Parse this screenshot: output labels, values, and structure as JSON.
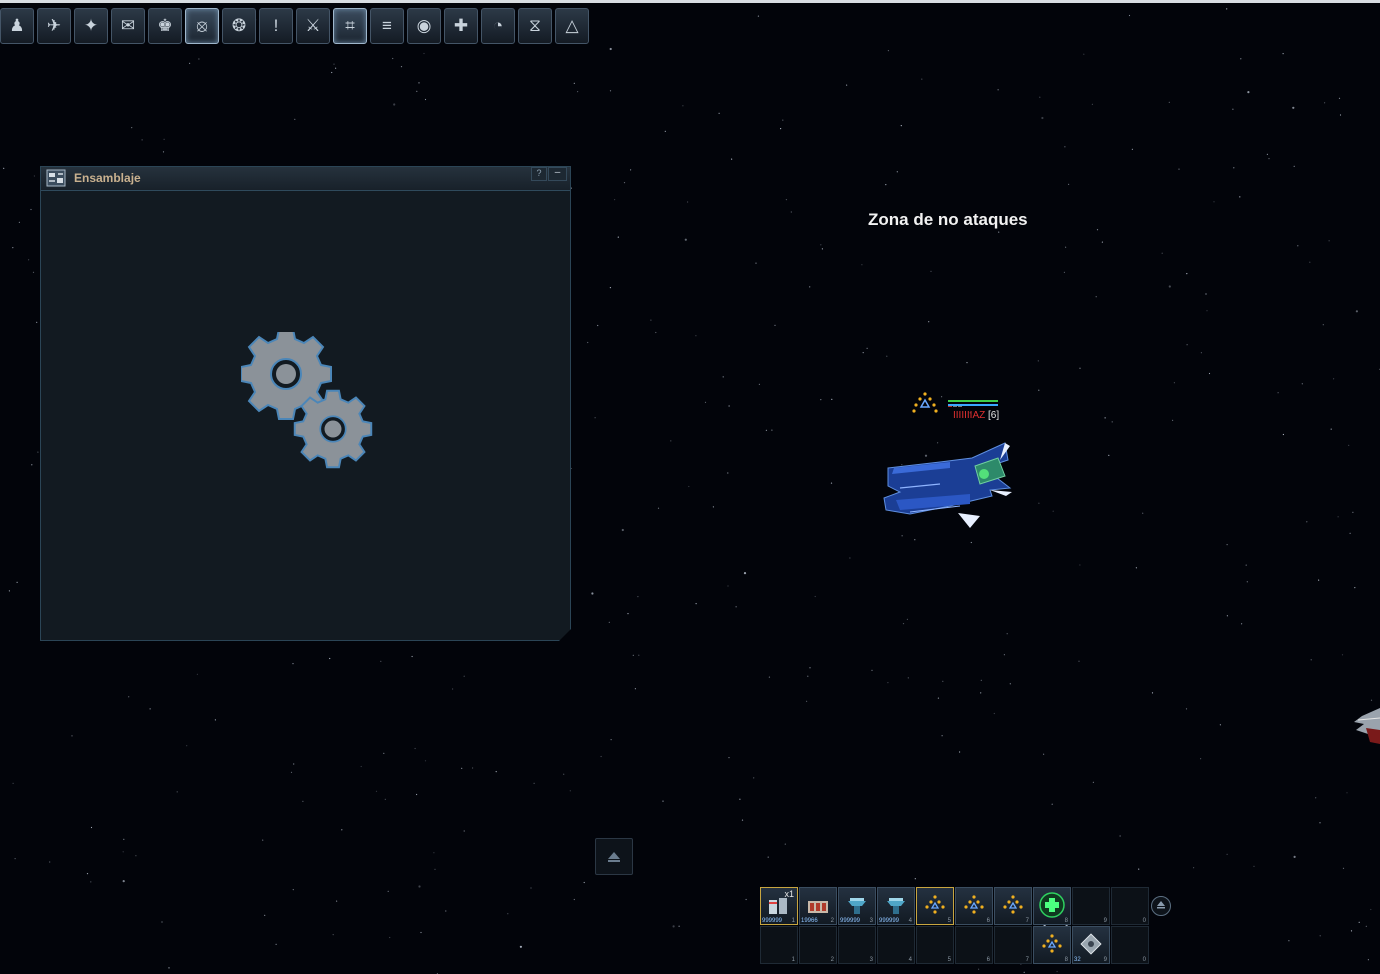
{
  "toolbar": {
    "buttons": [
      {
        "name": "user-icon",
        "glyph": "♟",
        "active": false
      },
      {
        "name": "ship-icon",
        "glyph": "✈",
        "active": false
      },
      {
        "name": "group-skills-icon",
        "glyph": "✦",
        "active": false
      },
      {
        "name": "chat-icon",
        "glyph": "✉",
        "active": false
      },
      {
        "name": "clan-icon",
        "glyph": "♚",
        "active": false
      },
      {
        "name": "minimap-icon",
        "glyph": "⦻",
        "active": true
      },
      {
        "name": "skills-icon",
        "glyph": "❂",
        "active": false
      },
      {
        "name": "quests-icon",
        "glyph": "!",
        "active": false
      },
      {
        "name": "weapons-icon",
        "glyph": "⚔",
        "active": false
      },
      {
        "name": "assembly-icon",
        "glyph": "⌗",
        "active": true
      },
      {
        "name": "log-icon",
        "glyph": "≡",
        "active": false
      },
      {
        "name": "location-pin-icon",
        "glyph": "◉",
        "active": false
      },
      {
        "name": "add-friend-icon",
        "glyph": "✚",
        "active": false
      },
      {
        "name": "speedometer-icon",
        "glyph": "◔",
        "active": false
      },
      {
        "name": "galaxy-gate-icon",
        "glyph": "⧖",
        "active": false
      },
      {
        "name": "pyramid-icon",
        "glyph": "△",
        "active": false
      }
    ]
  },
  "window": {
    "title": "Ensamblaje",
    "help": "?",
    "minimize": "–"
  },
  "zone": {
    "message": "Zona de no ataques"
  },
  "player": {
    "name": "IIIIIIIAZ",
    "level": "[6]"
  },
  "actionbar": {
    "row1": [
      {
        "num": "1",
        "amount": "999999",
        "icon": "laser-ammo-icon",
        "filled": true,
        "selected": true,
        "x": "x1"
      },
      {
        "num": "2",
        "amount": "19966",
        "icon": "rocket-ammo-icon",
        "filled": true,
        "selected": false
      },
      {
        "num": "3",
        "amount": "999999",
        "icon": "cpu-icon",
        "filled": true,
        "selected": false
      },
      {
        "num": "4",
        "amount": "999999",
        "icon": "cpu-icon",
        "filled": true,
        "selected": false
      },
      {
        "num": "5",
        "amount": "",
        "icon": "formation-icon",
        "filled": true,
        "selected": true
      },
      {
        "num": "6",
        "amount": "",
        "icon": "formation-icon",
        "filled": true,
        "selected": false
      },
      {
        "num": "7",
        "amount": "",
        "icon": "formation-icon",
        "filled": true,
        "selected": false
      },
      {
        "num": "8",
        "amount": "",
        "icon": "repair-icon",
        "filled": true,
        "selected": false
      },
      {
        "num": "9",
        "amount": "",
        "icon": "",
        "filled": false,
        "selected": false
      },
      {
        "num": "0",
        "amount": "",
        "icon": "",
        "filled": false,
        "selected": false
      }
    ],
    "row2": [
      {
        "num": "1",
        "amount": "",
        "icon": "",
        "filled": false
      },
      {
        "num": "2",
        "amount": "",
        "icon": "",
        "filled": false
      },
      {
        "num": "3",
        "amount": "",
        "icon": "",
        "filled": false
      },
      {
        "num": "4",
        "amount": "",
        "icon": "",
        "filled": false
      },
      {
        "num": "5",
        "amount": "",
        "icon": "",
        "filled": false
      },
      {
        "num": "6",
        "amount": "",
        "icon": "",
        "filled": false
      },
      {
        "num": "7",
        "amount": "",
        "icon": "",
        "filled": false
      },
      {
        "num": "8",
        "amount": "",
        "icon": "formation-icon",
        "filled": true
      },
      {
        "num": "9",
        "amount": "32",
        "icon": "mine-icon",
        "filled": true
      },
      {
        "num": "0",
        "amount": "",
        "icon": "",
        "filled": false
      }
    ]
  },
  "colors": {
    "space": "#02040a",
    "window_title": "#c9b18f",
    "hp": "#3fcf4a",
    "shield": "#3aa8ff",
    "pilot_name": "#e03030"
  }
}
